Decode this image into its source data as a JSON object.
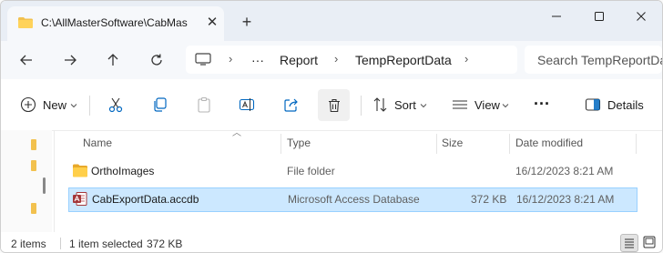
{
  "window": {
    "tab_title": "C:\\AllMasterSoftware\\CabMas",
    "new_tab_symbol": "+",
    "close_tab_symbol": "✕"
  },
  "address": {
    "more": "···",
    "crumbs": [
      "Report",
      "TempReportData"
    ]
  },
  "search": {
    "placeholder": "Search TempReportData"
  },
  "toolbar": {
    "new_label": "New",
    "sort_label": "Sort",
    "view_label": "View",
    "more_label": "···",
    "details_label": "Details"
  },
  "columns": {
    "name": "Name",
    "type": "Type",
    "size": "Size",
    "date": "Date modified"
  },
  "files": [
    {
      "name": "OrthoImages",
      "type": "File folder",
      "size": "",
      "date": "16/12/2023 8:21 AM",
      "icon": "folder-icon",
      "selected": false
    },
    {
      "name": "CabExportData.accdb",
      "type": "Microsoft Access Database",
      "size": "372 KB",
      "date": "16/12/2023 8:21 AM",
      "icon": "access-file-icon",
      "selected": true
    }
  ],
  "status": {
    "item_count": "2 items",
    "selected": "1 item selected",
    "selected_size": "372 KB"
  },
  "colors": {
    "accent": "#0067c0",
    "folder": "#f2c14e",
    "selection": "#cce8ff",
    "access_red": "#a4373a"
  }
}
